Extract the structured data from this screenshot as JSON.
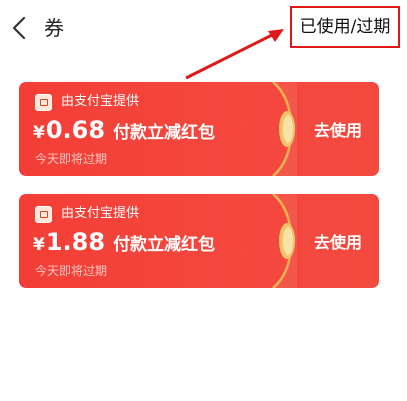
{
  "header": {
    "title": "券",
    "back_icon": "chevron-left-icon",
    "used_expired_label": "已使用/过期"
  },
  "coupons": [
    {
      "provider": "由支付宝提供",
      "currency": "¥",
      "amount": "0.68",
      "title": "付款立减红包",
      "expire": "今天即将过期",
      "button": "去使用"
    },
    {
      "provider": "由支付宝提供",
      "currency": "¥",
      "amount": "1.88",
      "title": "付款立减红包",
      "expire": "今天即将过期",
      "button": "去使用"
    }
  ],
  "colors": {
    "coupon_red": "#f3443b",
    "annotation_red": "#e01818",
    "divider_gold": "#e8b451"
  }
}
